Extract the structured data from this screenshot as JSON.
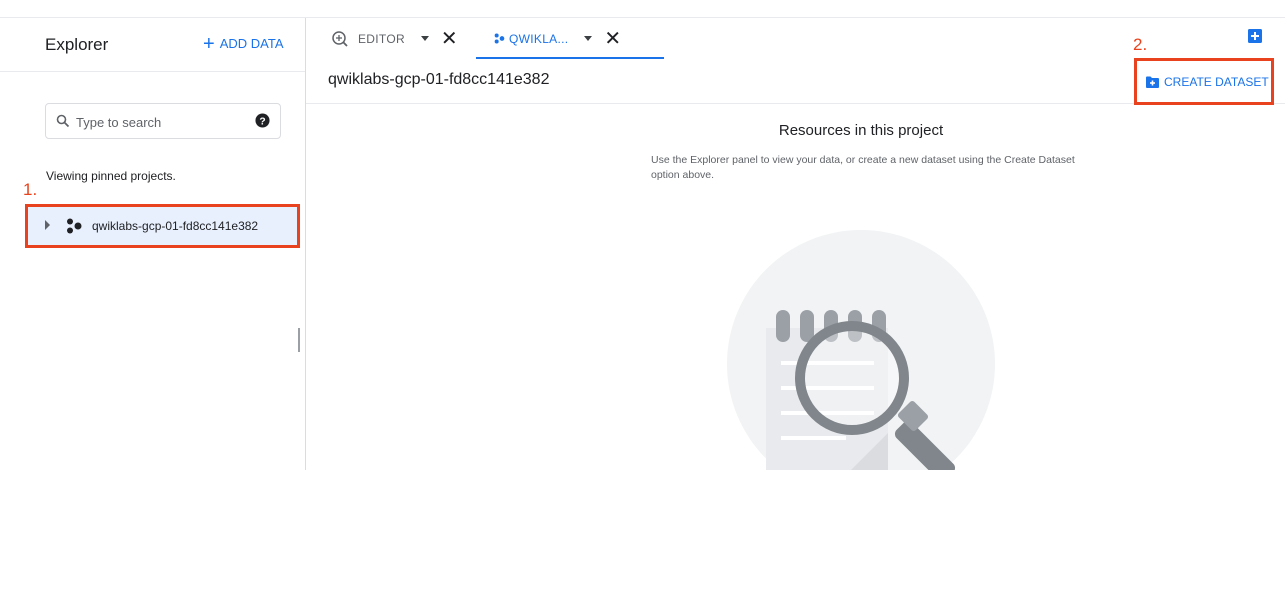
{
  "explorer": {
    "title": "Explorer",
    "add_data_label": "ADD DATA",
    "search_placeholder": "Type to search",
    "viewing_text": "Viewing pinned projects.",
    "project_name": "qwiklabs-gcp-01-fd8cc141e382"
  },
  "tabs": [
    {
      "label": "EDITOR",
      "icon": "query-editor-icon",
      "active": false
    },
    {
      "label": "QWIKLA...",
      "icon": "project-icon",
      "active": true
    }
  ],
  "main": {
    "project_title": "qwiklabs-gcp-01-fd8cc141e382",
    "create_dataset_label": "CREATE DATASET",
    "resources_title": "Resources in this project",
    "resources_desc": "Use the Explorer panel to view your data, or create a new dataset using the Create Dataset option above."
  },
  "annotations": {
    "step1": "1.",
    "step2": "2."
  },
  "colors": {
    "accent": "#1a73e8",
    "highlight": "#e8431e"
  }
}
